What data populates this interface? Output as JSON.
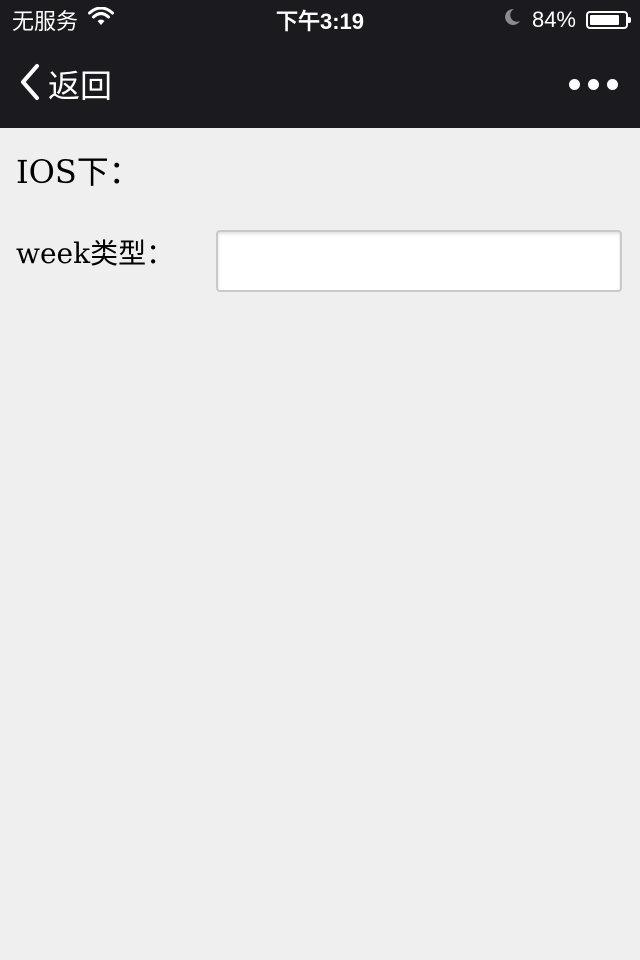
{
  "status_bar": {
    "carrier": "无服务",
    "time": "下午3:19",
    "battery_percent_label": "84%",
    "battery_level": 0.84
  },
  "nav": {
    "back_label": "返回"
  },
  "content": {
    "section_title": "IOS下：",
    "field_label": "week类型：",
    "week_input_value": ""
  },
  "colors": {
    "bar_background": "#1b1a1f",
    "page_background": "#efefef"
  },
  "icons": {
    "wifi": "wifi-icon",
    "moon": "moon-icon",
    "battery": "battery-icon",
    "back": "chevron-left-icon",
    "more": "more-dots-icon"
  }
}
